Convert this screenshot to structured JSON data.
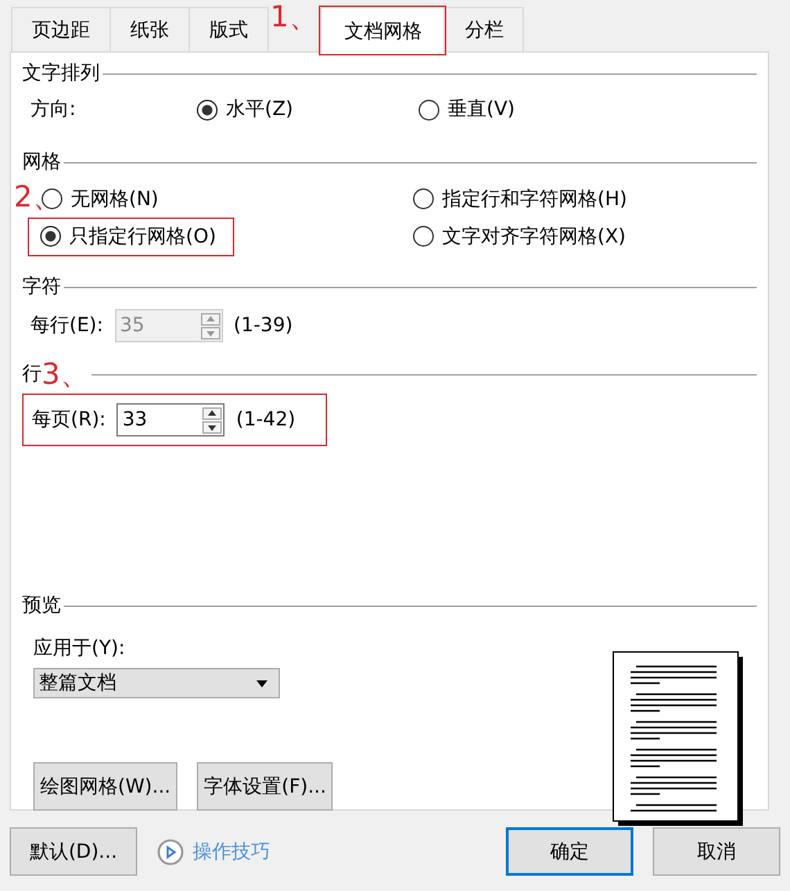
{
  "tabs": [
    {
      "label": "页边距",
      "selected": false
    },
    {
      "label": "纸张",
      "selected": false
    },
    {
      "label": "版式",
      "selected": false
    },
    {
      "label": "文档网格",
      "selected": true,
      "annotation": "1、"
    },
    {
      "label": "分栏",
      "selected": false
    }
  ],
  "text_direction": {
    "title": "文字排列",
    "label": "方向:",
    "options": [
      {
        "label": "水平(Z)",
        "selected": true
      },
      {
        "label": "垂直(V)",
        "selected": false
      }
    ]
  },
  "grid": {
    "title": "网格",
    "options": [
      {
        "label": "无网格(N)",
        "selected": false
      },
      {
        "label": "只指定行网格(O)",
        "selected": true,
        "annotation": "2、"
      },
      {
        "label": "指定行和字符网格(H)",
        "selected": false
      },
      {
        "label": "文字对齐字符网格(X)",
        "selected": false
      }
    ]
  },
  "characters": {
    "title": "字符",
    "label": "每行(E):",
    "value": "35",
    "disabled": true,
    "range": "(1-39)"
  },
  "lines": {
    "title": "行",
    "label": "每页(R):",
    "value": "33",
    "disabled": false,
    "range": "(1-42)",
    "annotation": "3、"
  },
  "preview": {
    "title": "预览",
    "apply_label": "应用于(Y):",
    "apply_value": "整篇文档"
  },
  "panel_buttons": [
    "绘图网格(W)...",
    "字体设置(F)..."
  ],
  "footer": {
    "default_button": "默认(D)...",
    "tips_link": "操作技巧",
    "buttons": [
      {
        "label": "确定",
        "kind": "primary"
      },
      {
        "label": "取消",
        "kind": "normal"
      }
    ]
  }
}
